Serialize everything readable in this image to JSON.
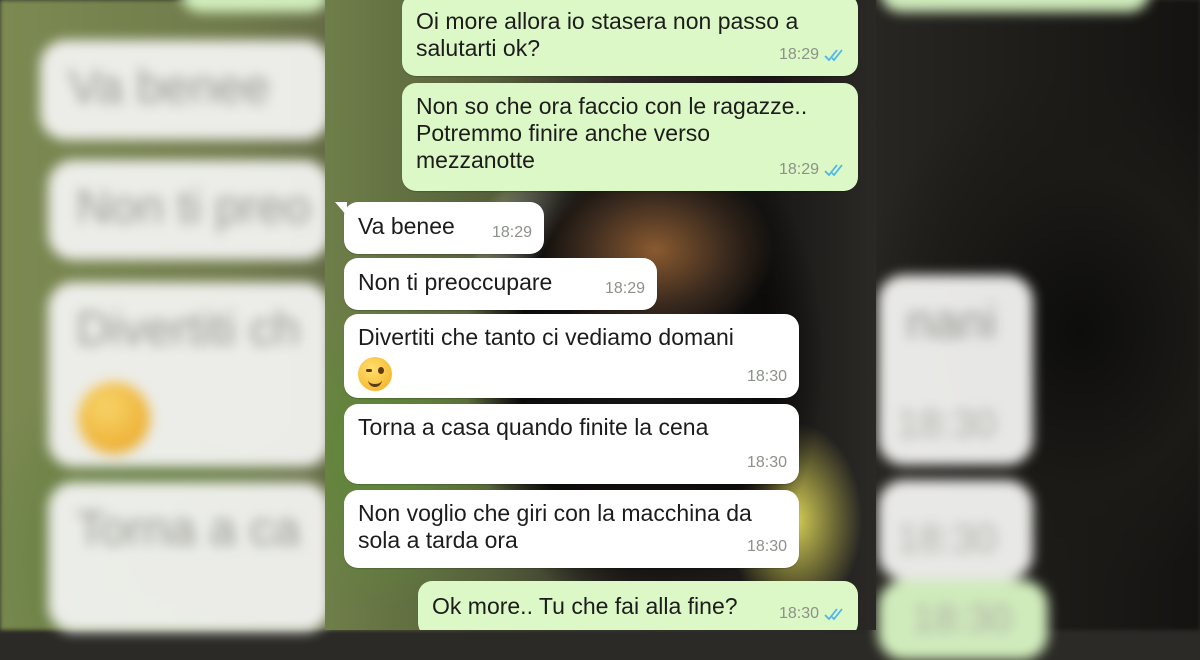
{
  "background_blur": {
    "bubbles": [
      {
        "text": "Va benee",
        "time": ""
      },
      {
        "text": "Non ti preo",
        "time": ""
      },
      {
        "text": "Divertiti ch",
        "time": ""
      },
      {
        "text": "Torna a ca",
        "time": ""
      },
      {
        "text": "",
        "time": ""
      },
      {
        "text": "",
        "time": ""
      },
      {
        "text": "nani",
        "time": "18:30"
      },
      {
        "text": "",
        "time": "18:30"
      },
      {
        "text": "",
        "time": "18:30"
      }
    ]
  },
  "messages": [
    {
      "direction": "out",
      "text": "Oi more allora io stasera non passo a\nsalutarti ok?",
      "time": "18:29",
      "status": "read",
      "has_emoji": false
    },
    {
      "direction": "out",
      "text": "Non so che ora faccio con le ragazze..\nPotremmo finire anche verso\nmezzanotte",
      "time": "18:29",
      "status": "read",
      "has_emoji": false
    },
    {
      "direction": "in",
      "text": "Va benee",
      "time": "18:29",
      "has_emoji": false
    },
    {
      "direction": "in",
      "text": "Non ti preoccupare",
      "time": "18:29",
      "has_emoji": false
    },
    {
      "direction": "in",
      "text": "Divertiti che tanto ci vediamo domani",
      "time": "18:30",
      "has_emoji": true,
      "emoji": "winking-face"
    },
    {
      "direction": "in",
      "text": "Torna a casa quando finite la cena",
      "time": "18:30",
      "has_emoji": false
    },
    {
      "direction": "in",
      "text": "Non voglio che giri con la macchina da\nsola a tarda ora",
      "time": "18:30",
      "has_emoji": false
    },
    {
      "direction": "out",
      "text": "Ok more.. Tu che fai alla fine?",
      "time": "18:30",
      "status": "read",
      "has_emoji": false
    }
  ],
  "colors": {
    "outgoing_bubble": "#dcf8c6",
    "incoming_bubble": "#ffffff",
    "read_ticks": "#4fb6ec",
    "timestamp": "#8d9189"
  }
}
